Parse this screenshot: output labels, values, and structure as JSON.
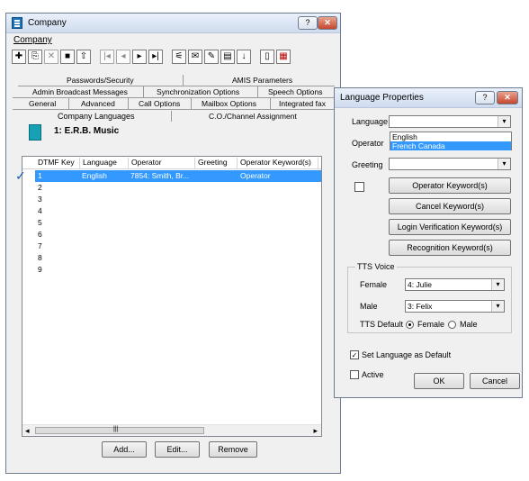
{
  "window": {
    "title": "Company",
    "help_glyph": "?",
    "close_glyph": "✕"
  },
  "menu": {
    "label": "Company"
  },
  "toolbar": {
    "icons": [
      "new-icon",
      "copy-icon",
      "delete-icon",
      "save-icon",
      "export-icon",
      "first-icon",
      "prev-icon",
      "next-icon",
      "last-icon",
      "find-icon",
      "filter-icon",
      "edit-icon",
      "notes-icon",
      "sort-icon",
      "report-icon",
      "print-icon"
    ],
    "glyphs": [
      "✚",
      "⎘",
      "✕",
      "■",
      "⇧",
      "|◂",
      "◂",
      "▸",
      "▸|",
      "⚟",
      "✉",
      "✎",
      "▤",
      "↓",
      "▯",
      "▦"
    ]
  },
  "tabs": {
    "row1": [
      "Passwords/Security",
      "AMIS Parameters"
    ],
    "row2": [
      "Admin Broadcast Messages",
      "Synchronization Options",
      "Speech Options"
    ],
    "row3": [
      "General",
      "Advanced",
      "Call Options",
      "Mailbox Options",
      "Integrated fax"
    ],
    "row4": [
      "Company Languages",
      "C.O./Channel Assignment"
    ]
  },
  "company": {
    "name": "1: E.R.B. Music"
  },
  "list": {
    "headers": [
      "DTMF Key",
      "Language",
      "Operator",
      "Greeting",
      "Operator Keyword(s)"
    ],
    "check_glyph": "✓",
    "rows": [
      {
        "key": "1",
        "language": "English",
        "operator": "7854: Smith, Br...",
        "greeting": "",
        "keywords": "Operator",
        "selected": true
      },
      {
        "key": "2"
      },
      {
        "key": "3"
      },
      {
        "key": "4"
      },
      {
        "key": "5"
      },
      {
        "key": "6"
      },
      {
        "key": "7"
      },
      {
        "key": "8"
      },
      {
        "key": "9"
      }
    ]
  },
  "buttons": {
    "add": "Add...",
    "edit": "Edit...",
    "remove": "Remove"
  },
  "dialog": {
    "title": "Language Properties",
    "help_glyph": "?",
    "close_glyph": "✕",
    "language_label": "Language",
    "language_value": "",
    "language_options": [
      "English",
      "French Canada"
    ],
    "language_selected": "French Canada",
    "operator_label": "Operator",
    "greeting_label": "Greeting",
    "greeting_value": "",
    "operator_keywords": "Operator Keyword(s)",
    "cancel_keywords": "Cancel Keyword(s)",
    "login_keywords": "Login Verification Keyword(s)",
    "recognition_keywords": "Recognition Keyword(s)",
    "tts": {
      "group": "TTS Voice",
      "female_label": "Female",
      "female_value": "4: Julie",
      "male_label": "Male",
      "male_value": "3: Felix",
      "default_label": "TTS Default",
      "opt_female": "Female",
      "opt_male": "Male",
      "default_selected": "Female"
    },
    "set_default": {
      "label": "Set Language as Default",
      "checked": true
    },
    "active": {
      "label": "Active",
      "checked": false
    },
    "ok": "OK",
    "cancel": "Cancel",
    "combo_arrow": "▾",
    "check_glyph": "✓"
  },
  "scroll": {
    "left": "◂",
    "right": "▸",
    "grip": "|||"
  }
}
